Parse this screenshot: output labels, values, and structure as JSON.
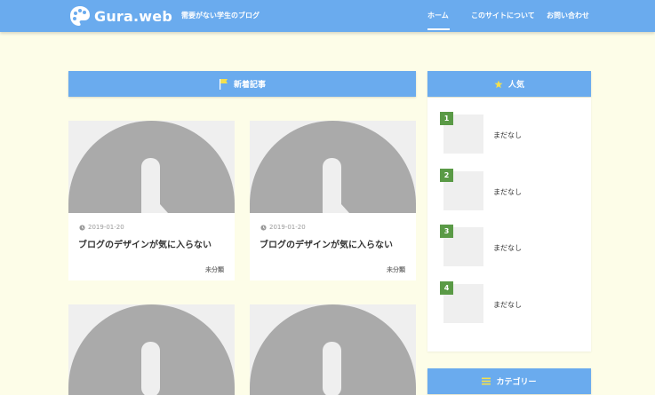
{
  "header": {
    "logo_text": "Gura.web",
    "tagline": "需要がない学生のブログ",
    "nav": [
      {
        "label": "ホーム"
      },
      {
        "label": "このサイトについて"
      },
      {
        "label": "お問い合わせ"
      }
    ]
  },
  "main": {
    "section_title": "新着記事",
    "cards": [
      {
        "date": "2019-01-20",
        "title": "ブログのデザインが気に入らない",
        "category": "未分類"
      },
      {
        "date": "2019-01-20",
        "title": "ブログのデザインが気に入らない",
        "category": "未分類"
      },
      {},
      {}
    ]
  },
  "sidebar": {
    "ranking_title": "人気",
    "ranking": [
      {
        "rank": "1",
        "text": "まだなし"
      },
      {
        "rank": "2",
        "text": "まだなし"
      },
      {
        "rank": "3",
        "text": "まだなし"
      },
      {
        "rank": "4",
        "text": "まだなし"
      }
    ],
    "category_title": "カテゴリー"
  },
  "colors": {
    "background": "#fdfde8",
    "header": "#6aabee",
    "rank_badge": "#5a9a46",
    "star": "#f4e04d"
  },
  "icons": {
    "logo": "palette-icon",
    "new_posts": "flag-icon",
    "ranking": "star-icon",
    "category": "menu-icon",
    "date": "clock-icon"
  }
}
